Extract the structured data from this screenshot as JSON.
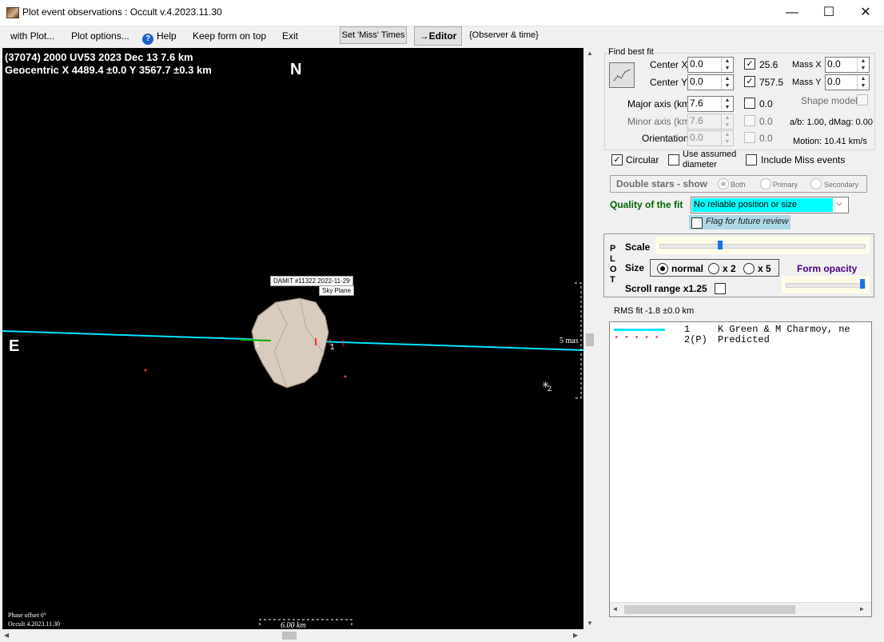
{
  "window": {
    "title": "Plot event observations : Occult v.4.2023.11.30",
    "minimize": "—",
    "maximize": "☐",
    "close": "✕"
  },
  "menu": {
    "with_plot": "with Plot...",
    "plot_options": "Plot options...",
    "help": "Help",
    "keep_on_top": "Keep form on top",
    "exit": "Exit",
    "set_miss": "Set 'Miss' Times",
    "editor": "→Editor",
    "observer_time": "{Observer & time}"
  },
  "plot": {
    "header_line1": "(37074) 2000 UV53  2023 Dec 13   7.6 km",
    "header_line2": "Geocentric  X  4489.4 ±0.0  Y 3567.7 ±0.3 km",
    "north": "N",
    "east": "E",
    "damit_label": "DAMIT #11322 2022-11-29",
    "sky_plane_label": "Sky Plane",
    "chord_label_1": "1",
    "chord_label_1b": "1",
    "scale_mas": "5 mas",
    "star_label": "2",
    "phase_offset": "Phase offset 0°",
    "occult_version": "Occult 4.2023.11.30",
    "scale_km": "6.00 km",
    "colors": {
      "chord": "#00e5ff",
      "observed": "#00b000",
      "predicted": "#ff3030",
      "shape": "#d9cbbd"
    }
  },
  "fit": {
    "group_title": "Find best fit",
    "center_x_label": "Center X",
    "center_x": "0.0",
    "center_y_label": "Center Y",
    "center_y": "0.0",
    "check1_value": "25.6",
    "check2_value": "757.5",
    "mass_x_label": "Mass X",
    "mass_x": "0.0",
    "mass_y_label": "Mass Y",
    "mass_y": "0.0",
    "major_label": "Major axis (km)",
    "major": "7.6",
    "major_check": "0.0",
    "shape_model": "Shape model",
    "minor_label": "Minor axis (km)",
    "minor": "7.6",
    "minor_check": "0.0",
    "ab_dmag": "a/b: 1.00, dMag: 0.00",
    "orientation_label": "Orientation",
    "orientation": "0.0",
    "orient_check": "0.0",
    "motion": "Motion: 10.41 km/s",
    "circular": "Circular",
    "use_assumed": "Use assumed",
    "diameter": "diameter",
    "include_miss": "Include Miss events",
    "double_stars": "Double stars - show",
    "both": "Both",
    "primary": "Primary",
    "secondary": "Secondary",
    "quality_label": "Quality of the fit",
    "quality_value": "No reliable position or size",
    "flag_review": "Flag for future review"
  },
  "plotpanel": {
    "p": "P",
    "l": "L",
    "o": "O",
    "t": "T",
    "scale": "Scale",
    "size": "Size",
    "normal": "normal",
    "x2": "x 2",
    "x5": "x 5",
    "form_opacity": "Form opacity",
    "scroll_range": "Scroll range x1.25"
  },
  "rms": "RMS fit -1.8 ±0.0 km",
  "legend": [
    {
      "num": "1",
      "name": "K Green & M Charmoy, ne"
    },
    {
      "num": "2(P)",
      "name": "Predicted"
    }
  ]
}
